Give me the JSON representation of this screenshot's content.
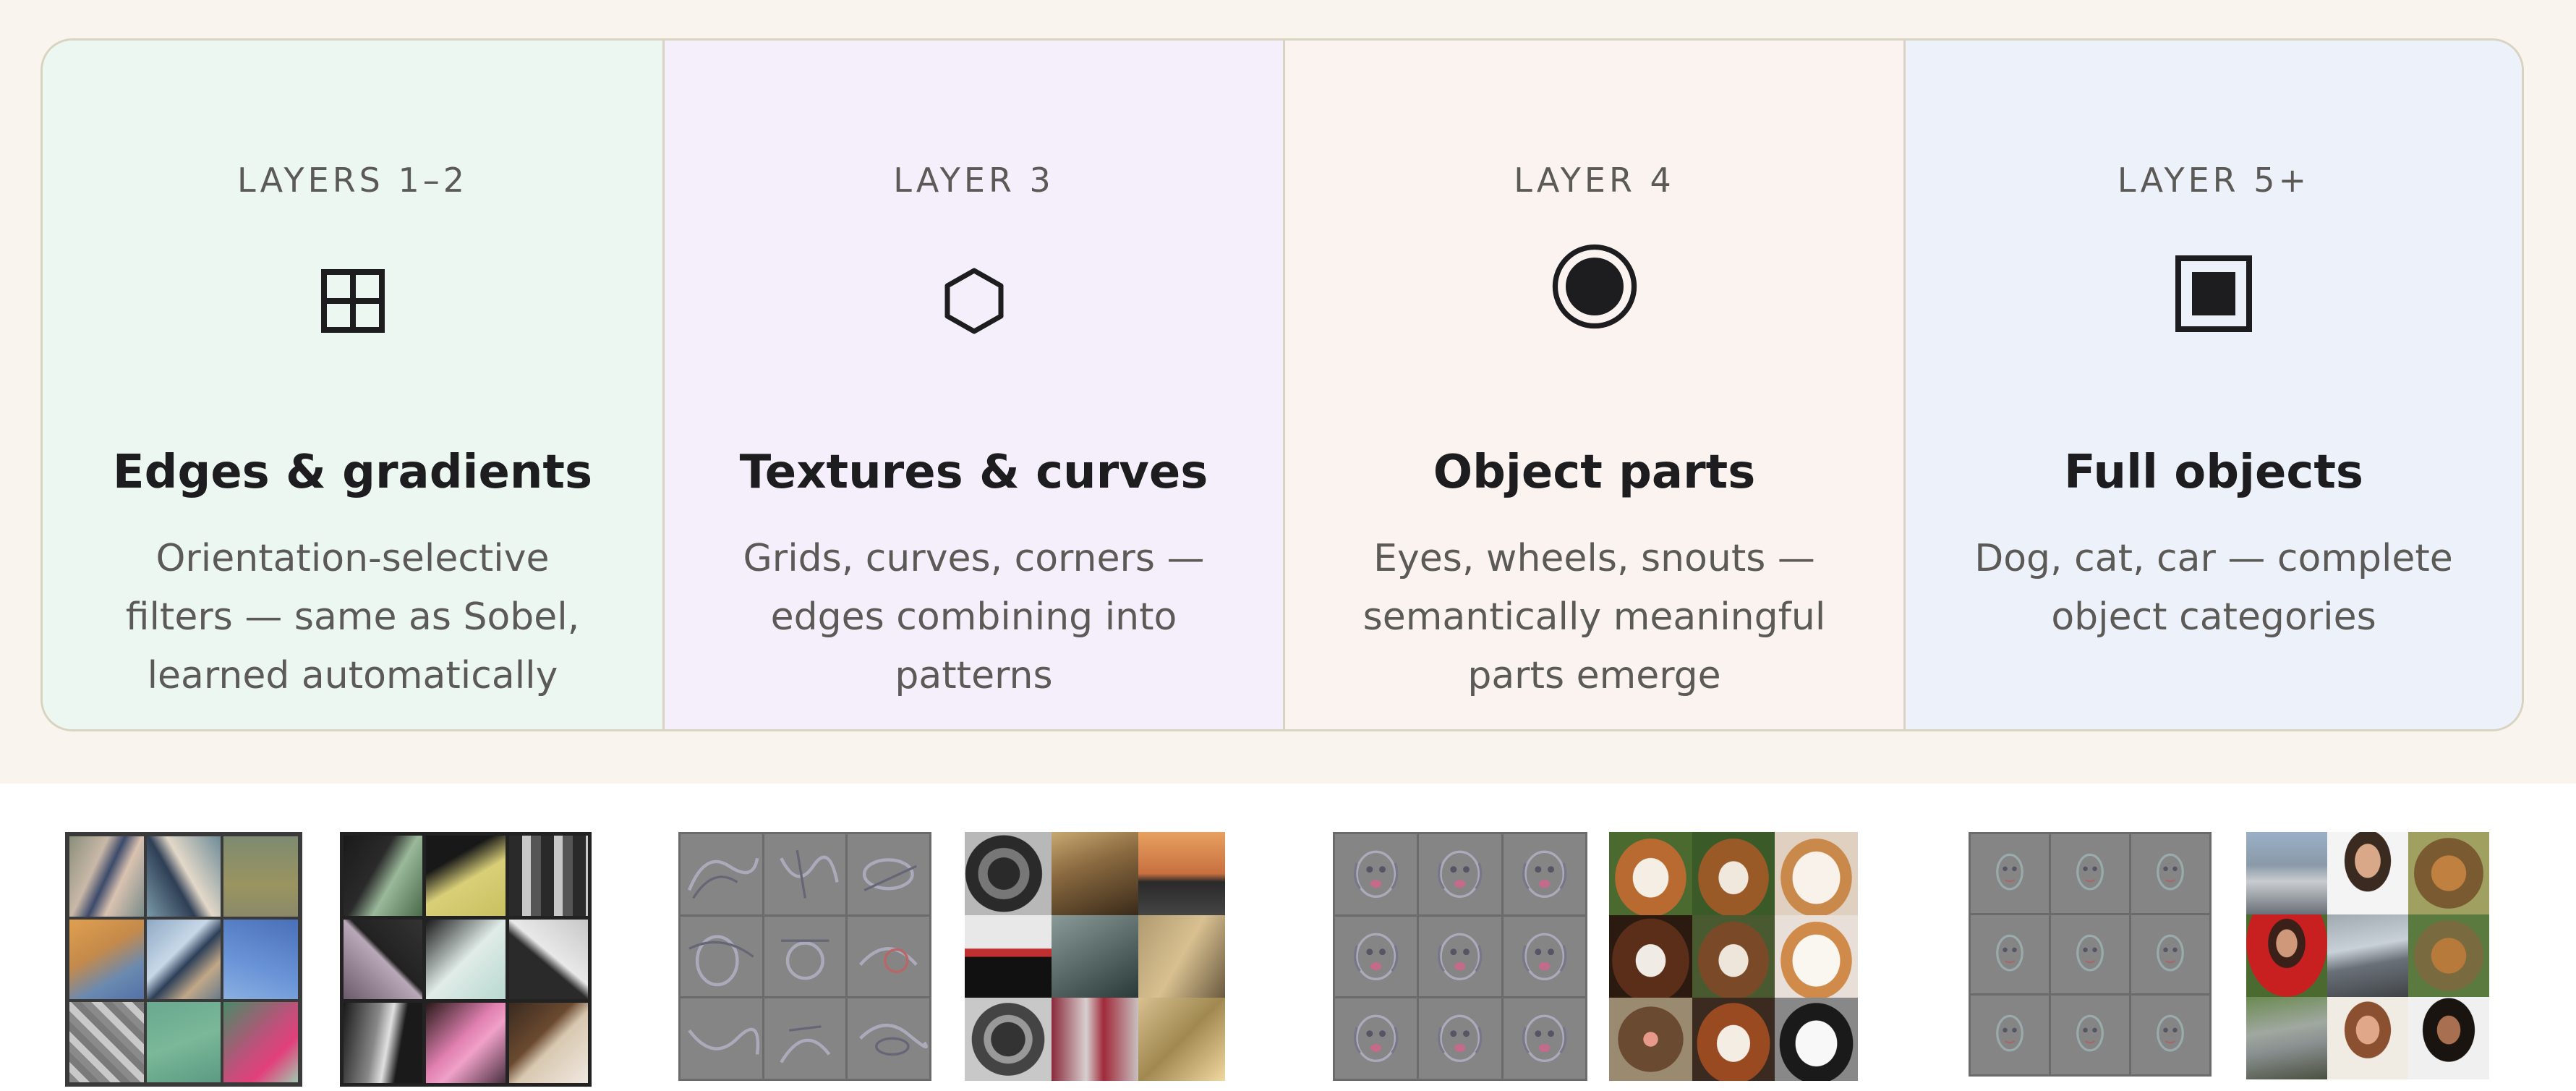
{
  "columns": [
    {
      "label": "LAYERS 1–2",
      "icon": "grid-icon",
      "title": "Edges & gradients",
      "desc": [
        "Orientation-selective",
        "filters — same as Sobel,",
        "learned automatically"
      ],
      "bg": "#ecf7f1"
    },
    {
      "label": "LAYER 3",
      "icon": "hexagon-icon",
      "title": "Textures & curves",
      "desc": [
        "Grids, curves, corners —",
        "edges combining into",
        "patterns"
      ],
      "bg": "#f4effa"
    },
    {
      "label": "LAYER 4",
      "icon": "target-circle-icon",
      "title": "Object parts",
      "desc": [
        "Eyes, wheels, snouts —",
        "semantically meaningful",
        "parts emerge"
      ],
      "bg": "#fbf3ef"
    },
    {
      "label": "LAYER 5+",
      "icon": "filled-square-icon",
      "title": "Full objects",
      "desc": [
        "Dog, cat, car — complete",
        "object categories"
      ],
      "bg": "#edf1fa"
    }
  ],
  "colors": {
    "band": "#f9f5ee",
    "border": "#d9d3c2",
    "label": "#5b5a57",
    "title": "#1d1d1f"
  },
  "thumbnails": [
    {
      "name": "layer1-filter-visualization",
      "kind": "filters-color"
    },
    {
      "name": "layer1-image-patches",
      "kind": "patches-edges"
    },
    {
      "name": "layer3-filter-visualization",
      "kind": "gray-curves"
    },
    {
      "name": "layer3-image-patches",
      "kind": "car-patches"
    },
    {
      "name": "layer4-filter-visualization",
      "kind": "gray-dogfaces"
    },
    {
      "name": "layer4-image-patches",
      "kind": "dog-patches"
    },
    {
      "name": "layer5-filter-visualization",
      "kind": "gray-faces"
    },
    {
      "name": "layer5-image-patches",
      "kind": "mixed-patches"
    }
  ]
}
